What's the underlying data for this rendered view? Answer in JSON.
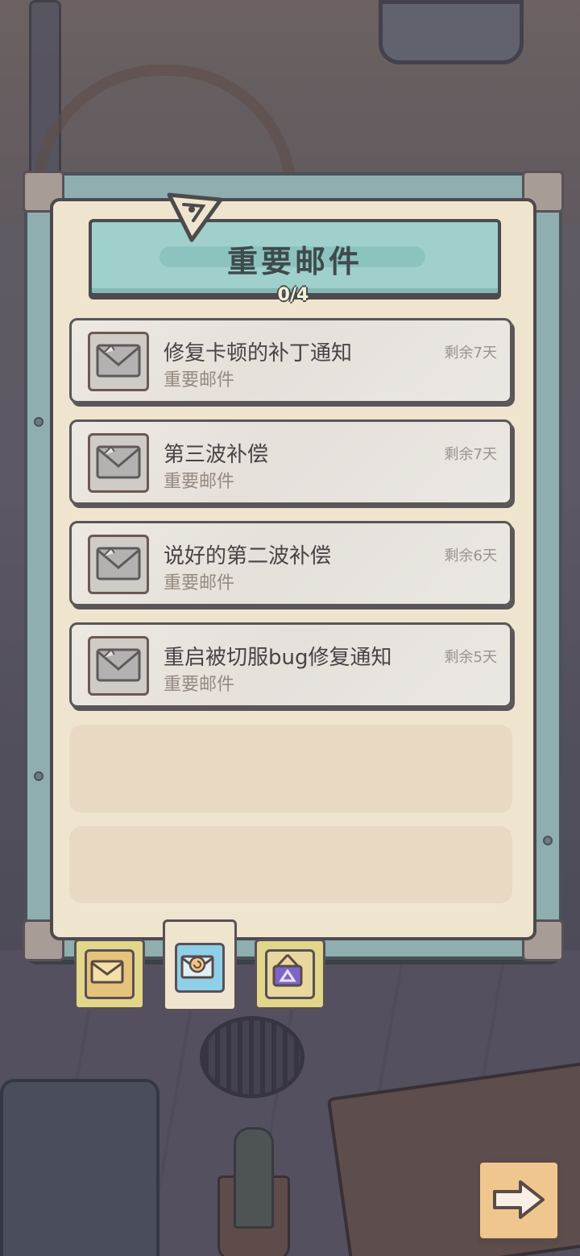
{
  "header": {
    "title": "重要邮件",
    "counter": "0/4"
  },
  "mails": [
    {
      "title": "修复卡顿的补丁通知",
      "category": "重要邮件",
      "remaining": "剩余7天"
    },
    {
      "title": "第三波补偿",
      "category": "重要邮件",
      "remaining": "剩余7天"
    },
    {
      "title": "说好的第二波补偿",
      "category": "重要邮件",
      "remaining": "剩余6天"
    },
    {
      "title": "重启被切服bug修复通知",
      "category": "重要邮件",
      "remaining": "剩余5天"
    }
  ],
  "tabs": [
    {
      "icon": "envelope-icon",
      "selected": false
    },
    {
      "icon": "important-envelope-icon",
      "selected": true
    },
    {
      "icon": "hanging-sign-icon",
      "selected": false
    }
  ],
  "next_button": {
    "icon": "arrow-right-icon"
  },
  "colors": {
    "panel": "#8eaeb0",
    "paper": "#efe5cf",
    "header": "#9fd0cc",
    "next": "#f0c68f"
  }
}
